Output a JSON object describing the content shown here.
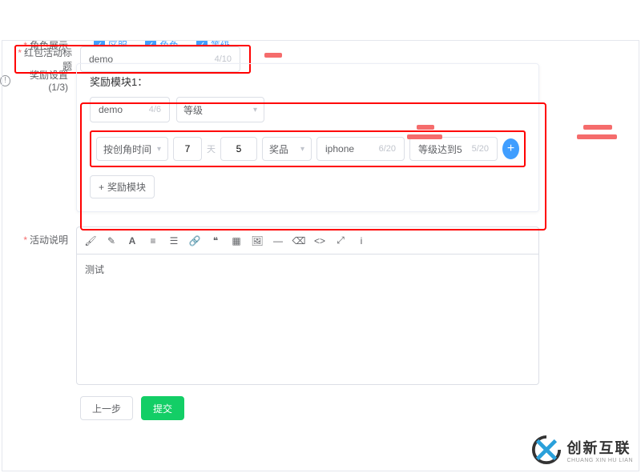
{
  "title_field": {
    "label": "红包活动标题",
    "value": "demo",
    "counter": "4/10"
  },
  "role_display": {
    "label": "角色展示",
    "options": [
      {
        "label": "区服",
        "checked": true
      },
      {
        "label": "角色",
        "checked": true
      },
      {
        "label": "等级",
        "checked": true
      }
    ]
  },
  "reward": {
    "label": "奖励设置(1/3)",
    "module_title": "奖励模块1：",
    "module_name": {
      "value": "demo",
      "counter": "4/6"
    },
    "module_type": "等级",
    "row": {
      "time_type": "按创角时间",
      "n1": "7",
      "unit1": "天",
      "n2": "5",
      "prize_label": "奖品",
      "prize_value": "iphone",
      "prize_counter": "6/20",
      "cond_value": "等级达到5",
      "cond_counter": "5/20"
    },
    "add_module": "奖励模块"
  },
  "desc": {
    "label": "活动说明",
    "content": "测试"
  },
  "footer": {
    "prev": "上一步",
    "submit": "提交"
  },
  "brand": {
    "cn": "创新互联",
    "en": "CHUANG XIN HU LIAN"
  }
}
